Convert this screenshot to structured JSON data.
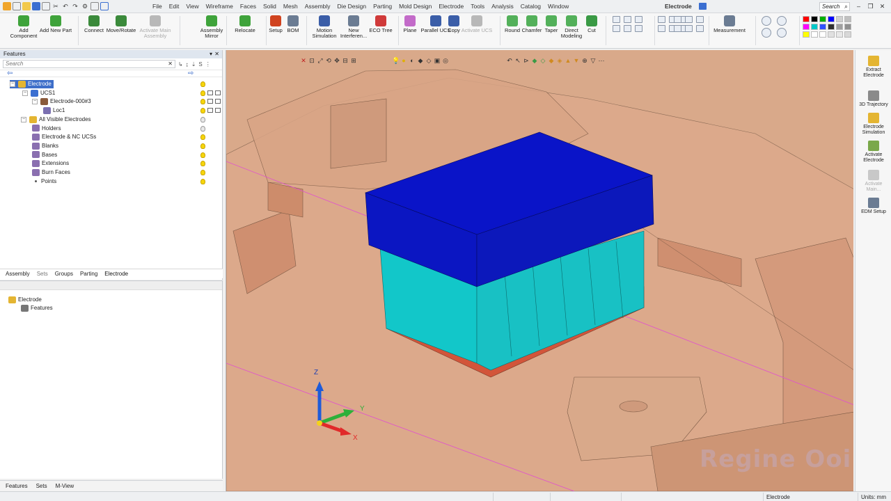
{
  "menu": {
    "items": [
      "File",
      "Edit",
      "View",
      "Wireframe",
      "Faces",
      "Solid",
      "Mesh",
      "Assembly",
      "Die Design",
      "Parting",
      "Mold Design",
      "Electrode",
      "Tools",
      "Analysis",
      "Catalog",
      "Window"
    ],
    "document_title": "Electrode",
    "search_placeholder": "Search"
  },
  "ribbon": {
    "buttons": [
      {
        "label": "Add\nComponent",
        "icon": "add-component-icon",
        "color": "#3fa33b"
      },
      {
        "label": "Add New Part",
        "icon": "add-new-part-icon",
        "color": "#3fa33b"
      },
      {
        "label": "Connect",
        "icon": "connect-icon",
        "color": "#3b8a3b"
      },
      {
        "label": "Move/Rotate",
        "icon": "move-rotate-icon",
        "color": "#3b8a3b"
      },
      {
        "label": "Activate Main\nAssembly",
        "icon": "activate-main-assembly-icon",
        "color": "#b8b8b8",
        "disabled": true
      },
      {
        "label": "Assembly\nMirror",
        "icon": "assembly-mirror-icon",
        "color": "#3fa33b"
      },
      {
        "label": "Relocate",
        "icon": "relocate-icon",
        "color": "#3fa33b"
      },
      {
        "label": "Setup",
        "icon": "setup-icon",
        "color": "#d0431f"
      },
      {
        "label": "BOM",
        "icon": "bom-icon",
        "color": "#6b7c93"
      },
      {
        "label": "Motion\nSimulation",
        "icon": "motion-simulation-icon",
        "color": "#3b5ea8"
      },
      {
        "label": "New\nInterferen...",
        "icon": "new-interference-icon",
        "color": "#6b7c93"
      },
      {
        "label": "ECO Tree",
        "icon": "eco-tree-icon",
        "color": "#d03a3a"
      },
      {
        "label": "Plane",
        "icon": "plane-icon",
        "color": "#c36bc9"
      },
      {
        "label": "Parallel UCS",
        "icon": "parallel-ucs-icon",
        "color": "#3b5ea8"
      },
      {
        "label": "Copy",
        "icon": "copy-icon",
        "color": "#3b5ea8"
      },
      {
        "label": "Activate UCS",
        "icon": "activate-ucs-icon",
        "color": "#b8b8b8",
        "disabled": true
      },
      {
        "label": "Round",
        "icon": "round-icon",
        "color": "#53b05a"
      },
      {
        "label": "Chamfer",
        "icon": "chamfer-icon",
        "color": "#53b05a"
      },
      {
        "label": "Taper",
        "icon": "taper-icon",
        "color": "#53b05a"
      },
      {
        "label": "Direct\nModeling",
        "icon": "direct-modeling-icon",
        "color": "#53b05a"
      },
      {
        "label": "Cut",
        "icon": "cut-icon",
        "color": "#3a9a45"
      },
      {
        "label": "Measurement",
        "icon": "measurement-icon",
        "color": "#6b7c93"
      }
    ],
    "palette_colors": [
      "#ff0000",
      "#000000",
      "#00b000",
      "#0000ff",
      "#d0d0d0",
      "#c0c0c0",
      "#ff00ff",
      "#00c8c8",
      "#3050ff",
      "#303030",
      "#a0a0a0",
      "#909090",
      "#ffff00",
      "#ffffff",
      "#ffffff",
      "#e0e0e0",
      "#e8e8e8",
      "#d8d8d8"
    ]
  },
  "features_panel": {
    "title": "Features",
    "search_placeholder": "Search",
    "tree": [
      {
        "label": "Electrode",
        "icon": "assembly-icon",
        "selected": true,
        "bulb": "on"
      },
      {
        "label": "UCS1",
        "icon": "ucs-icon",
        "bulb": "on"
      },
      {
        "label": "Electrode-000#3",
        "icon": "electrode-part-icon",
        "bulb": "on"
      },
      {
        "label": "Loc1",
        "icon": "location-icon",
        "bulb": "on"
      },
      {
        "label": "All Visible Electrodes",
        "icon": "folder-icon",
        "bulb": "off"
      },
      {
        "label": "Holders",
        "icon": "holders-icon",
        "bulb": "off"
      },
      {
        "label": "Electrode & NC UCSs",
        "icon": "ucs-set-icon",
        "bulb": "on"
      },
      {
        "label": "Blanks",
        "icon": "blanks-icon",
        "bulb": "on"
      },
      {
        "label": "Bases",
        "icon": "bases-icon",
        "bulb": "on"
      },
      {
        "label": "Extensions",
        "icon": "extensions-icon",
        "bulb": "on"
      },
      {
        "label": "Burn Faces",
        "icon": "burn-faces-icon",
        "bulb": "on"
      },
      {
        "label": "Points",
        "icon": "points-icon",
        "bulb": "on"
      }
    ],
    "tabs": [
      "Assembly",
      "Sets",
      "Groups",
      "Parting",
      "Electrode"
    ]
  },
  "lower_panel": {
    "tree": [
      {
        "label": "Electrode",
        "icon": "assembly-icon"
      },
      {
        "label": "Features",
        "icon": "features-icon"
      }
    ]
  },
  "bottom_tabs": [
    "Features",
    "Sets",
    "M-View"
  ],
  "viewport": {
    "axis_labels": {
      "z": "Z",
      "y": "Y",
      "x": "X"
    },
    "watermark": "Regine Ooi"
  },
  "right_panel": [
    {
      "label": "Extract\nElectrode",
      "icon": "extract-electrode-icon"
    },
    {
      "label": "3D Trajectory",
      "icon": "3d-trajectory-icon"
    },
    {
      "label": "Electrode\nSimulation",
      "icon": "electrode-simulation-icon"
    },
    {
      "label": "Activate\nElectrode",
      "icon": "activate-electrode-icon"
    },
    {
      "label": "Activate\nMain...",
      "icon": "activate-main-icon",
      "disabled": true
    },
    {
      "label": "EDM Setup",
      "icon": "edm-setup-icon"
    }
  ],
  "status": {
    "mode": "Electrode",
    "units": "Units: mm"
  }
}
